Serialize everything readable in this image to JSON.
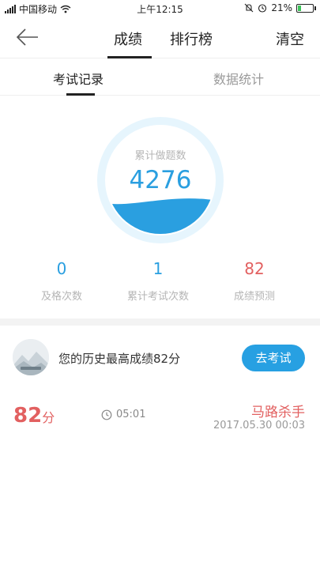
{
  "status_bar": {
    "carrier": "中国移动",
    "time": "上午12:15",
    "battery_text": "21%",
    "battery_level": 0.21,
    "icons": [
      "signal-icon",
      "wifi-icon",
      "alarm-off-icon",
      "alarm-icon",
      "battery-icon"
    ]
  },
  "nav": {
    "back_icon": "back-arrow-icon",
    "tabs": [
      {
        "label": "成绩",
        "active": true
      },
      {
        "label": "排行榜",
        "active": false
      }
    ],
    "clear_label": "清空"
  },
  "subtabs": [
    {
      "label": "考试记录",
      "active": true
    },
    {
      "label": "数据统计",
      "active": false
    }
  ],
  "gauge": {
    "label": "累计做题数",
    "value": "4276",
    "fill_level": 0.32,
    "ring_color": "#e6f5fd",
    "wave_color": "#2a9fe0"
  },
  "stats": [
    {
      "value": "0",
      "label": "及格次数",
      "color": "#2a9fe0"
    },
    {
      "value": "1",
      "label": "累计考试次数",
      "color": "#2a9fe0"
    },
    {
      "value": "82",
      "label": "成绩预测",
      "color": "#e26060"
    }
  ],
  "best": {
    "text": "您的历史最高成绩82分",
    "button_label": "去考试"
  },
  "records": [
    {
      "score": "82",
      "unit": "分",
      "duration": "05:01",
      "title": "马路杀手",
      "date": "2017.05.30  00:03"
    }
  ],
  "colors": {
    "accent": "#27a0e2",
    "danger": "#e26060"
  }
}
